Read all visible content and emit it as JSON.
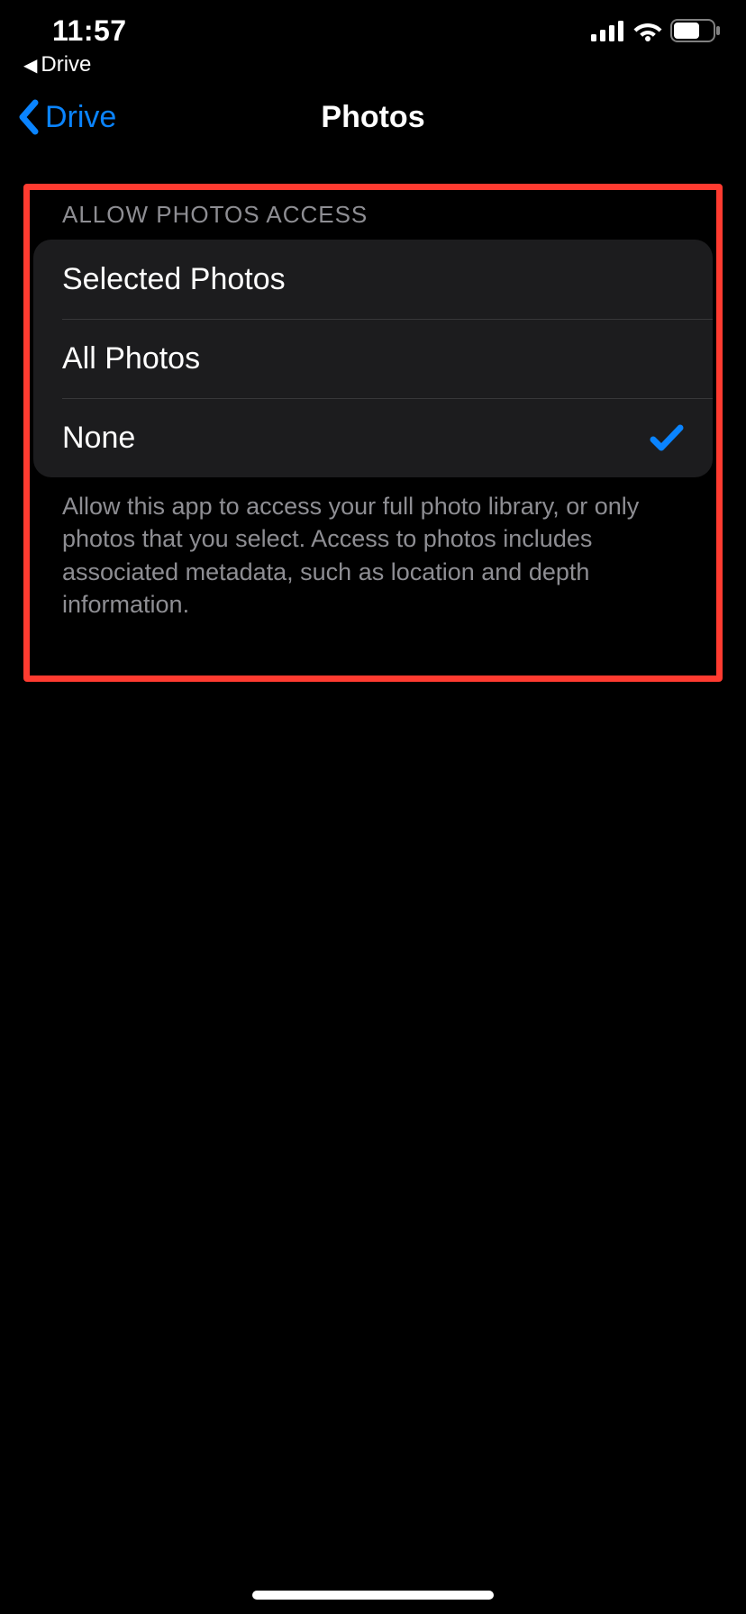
{
  "status": {
    "time": "11:57",
    "breadcrumb_app": "Drive"
  },
  "nav": {
    "back_label": "Drive",
    "title": "Photos"
  },
  "section": {
    "header": "Allow Photos Access",
    "footer": "Allow this app to access your full photo library, or only photos that you select. Access to photos includes associated metadata, such as location and depth information.",
    "options": {
      "selected_photos": "Selected Photos",
      "all_photos": "All Photos",
      "none": "None"
    },
    "selected": "none"
  }
}
